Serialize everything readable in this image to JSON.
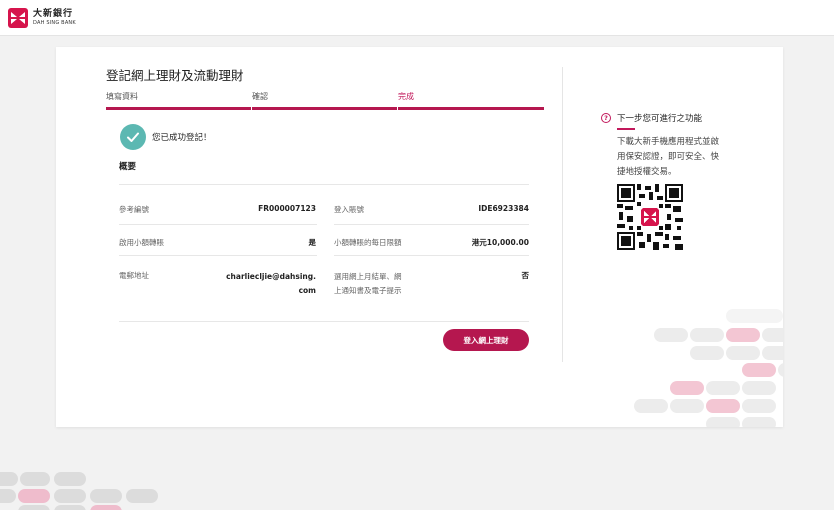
{
  "bank": {
    "name_zh": "大新銀行",
    "name_en": "DAH SING BANK"
  },
  "page": {
    "title": "登記網上理財及流動理財"
  },
  "steps": [
    {
      "label": "填寫資料"
    },
    {
      "label": "確認"
    },
    {
      "label": "完成"
    }
  ],
  "success": {
    "message": "您已成功登記！"
  },
  "summary": {
    "title": "概要",
    "rows": [
      {
        "label1": "參考編號",
        "value1": "FR000007123",
        "label2": "登入賬號",
        "value2": "IDE6923384"
      },
      {
        "label1": "啟用小額轉賬",
        "value1": "是",
        "label2": "小額轉賬的每日限額",
        "value2": "港元10,000.00"
      },
      {
        "label1": "電郵地址",
        "value1_line1": "charliecljie@dahsing.",
        "value1_line2": "com",
        "label2_line1": "選用網上月結單、網",
        "label2_line2": "上通知書及電子提示",
        "value2": "否"
      }
    ]
  },
  "actions": {
    "login_label": "登入網上理財"
  },
  "next": {
    "title": "下一步您可進行之功能",
    "desc_lines": [
      "下載大新手機應用程式並啟",
      "用保安認證，即可安全、快",
      "捷地授權交易。"
    ]
  },
  "colors": {
    "brand": "#b5174f",
    "success": "#5cb8b2",
    "accent": "#c2185b"
  },
  "icons": {
    "success": "check-icon",
    "next": "question-icon",
    "qr": "qr-code"
  }
}
